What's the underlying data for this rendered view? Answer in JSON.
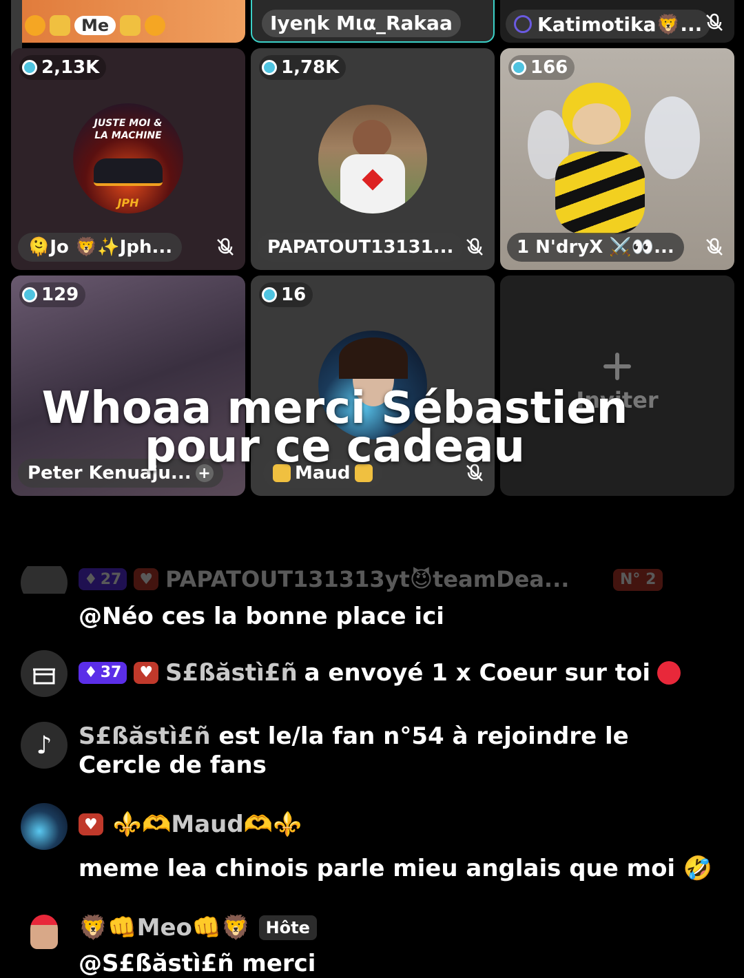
{
  "top_row": {
    "left_label": "Me",
    "center_name": "Iyeηk Mια_Rakaa",
    "right_name": "Katimotika🦁..."
  },
  "tiles": [
    {
      "count": "2,13K",
      "name": "🫠Jo 🦁✨Jph...",
      "logo_line1": "JUSTE MOI &",
      "logo_line2": "LA MACHINE",
      "logo_line3": "JPH"
    },
    {
      "count": "1,78K",
      "name": "PAPATOUT13131..."
    },
    {
      "count": "166",
      "name": "1 N'dryX ⚔️👀..."
    },
    {
      "count": "129",
      "name": "Peter Kenuaju..."
    },
    {
      "count": "16",
      "name": "Maud"
    },
    {
      "invite_label": "Inviter"
    }
  ],
  "overlay_caption": "Whoaa merci Sébastien pour ce cadeau",
  "chat": {
    "faded_row": {
      "level": "27",
      "user": "PAPATOUT131313yt😈teamDea...",
      "rank": "N° 2"
    },
    "messages": [
      {
        "text": "@Néo ces la bonne place ici"
      },
      {
        "level": "37",
        "user": "S£ßăstì£ñ",
        "action": "a envoyé 1 x Coeur sur toi"
      },
      {
        "user": "S£ßăstì£ñ",
        "action": "est le/la fan n°54 à rejoindre le Cercle de fans"
      },
      {
        "user": "⚜️🫶Maud🫶⚜️",
        "text": "meme lea chinois parle mieu anglais que moi 🤣"
      },
      {
        "user": "🦁👊Meo👊🦁",
        "role": "Hôte",
        "text": "@S£ßăstì£ñ merci"
      }
    ]
  },
  "colors": {
    "background": "#000000",
    "tile": "#2a2a2a",
    "level_badge": "#5b2ee8",
    "fan_badge": "#c0392b"
  }
}
